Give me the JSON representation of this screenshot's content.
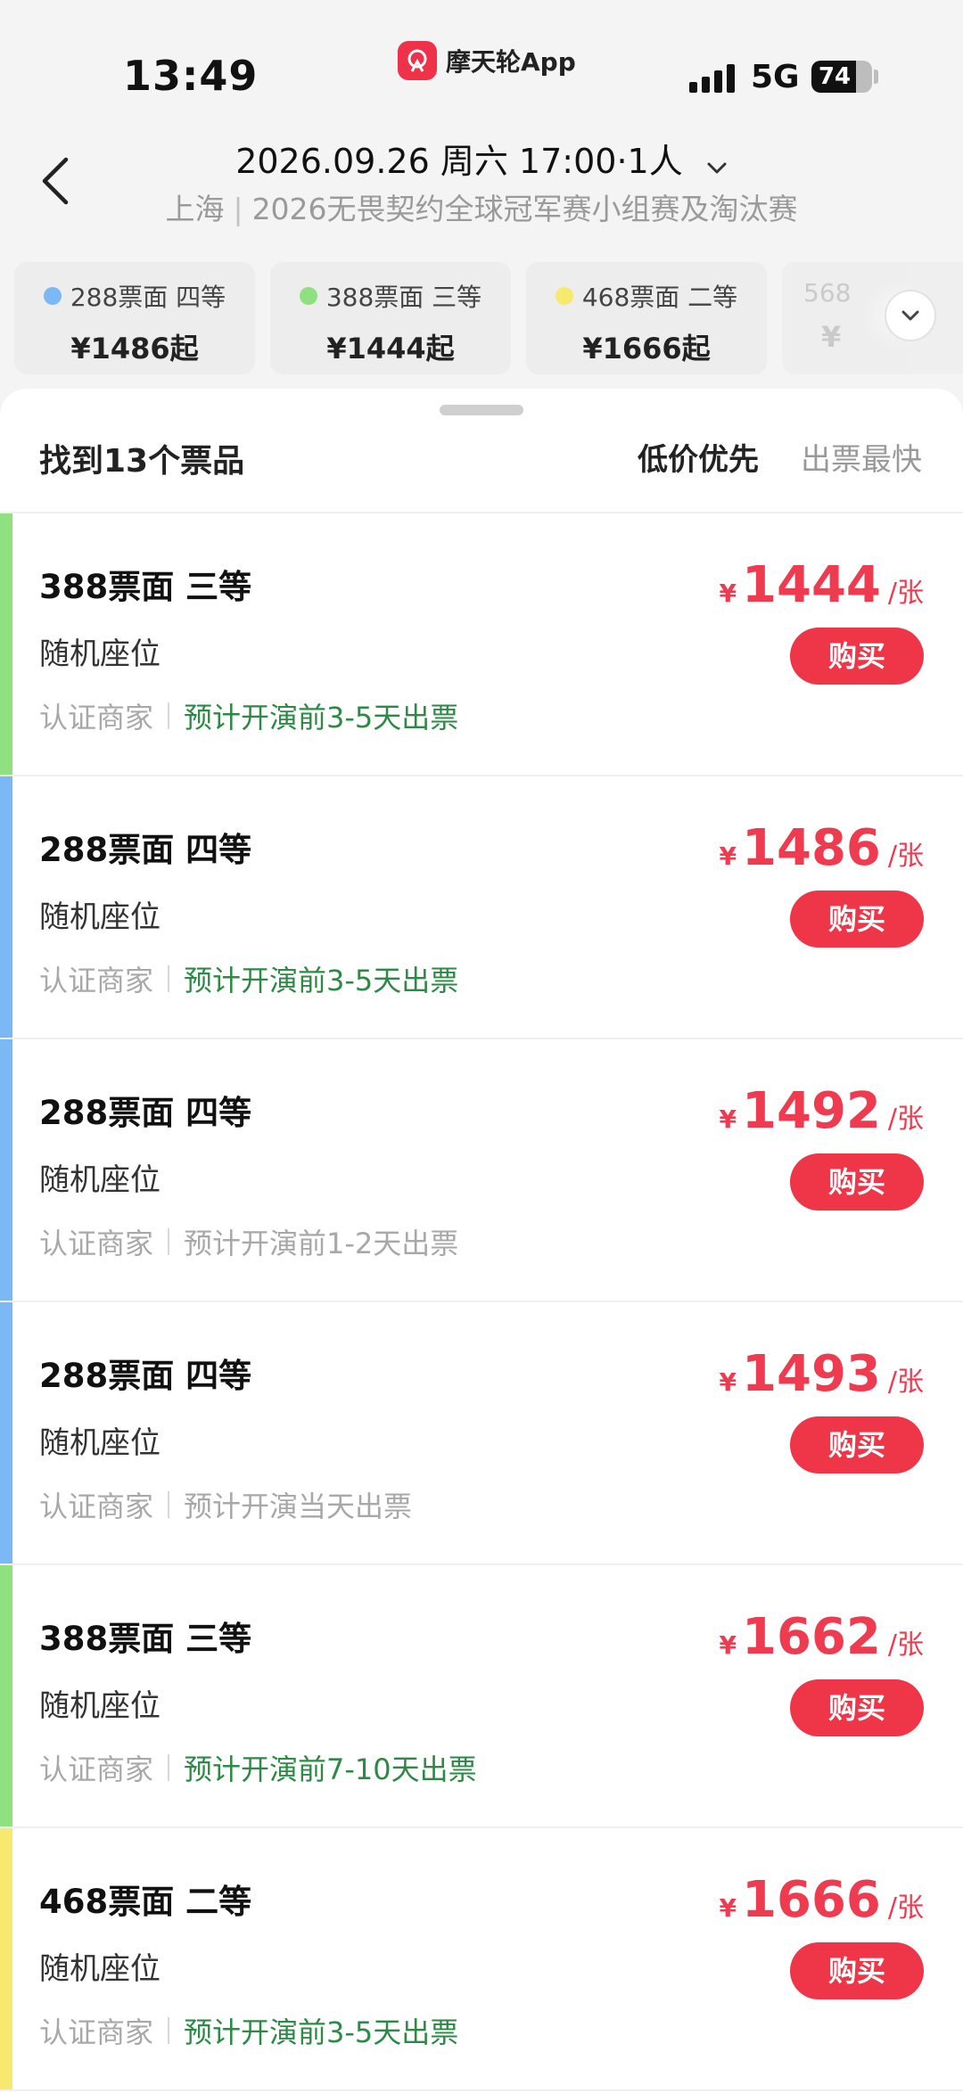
{
  "status_bar": {
    "time": "13:49",
    "app_name": "摩天轮App",
    "network": "5G",
    "battery": "74",
    "battery_level": 0.74
  },
  "header": {
    "title": "2026.09.26 周六 17:00·1人",
    "city": "上海",
    "separator": "|",
    "event": "2026无畏契约全球冠军赛小组赛及淘汰赛"
  },
  "chips": [
    {
      "label": "288票面 四等",
      "price": "¥1486起",
      "color": "#7ab9f5"
    },
    {
      "label": "388票面 三等",
      "price": "¥1444起",
      "color": "#8fe07e"
    },
    {
      "label": "468票面 二等",
      "price": "¥1666起",
      "color": "#f7e86e"
    },
    {
      "label": "568",
      "price": "¥",
      "color": ""
    }
  ],
  "results": {
    "count_text": "找到13个票品",
    "sort_low_price": "低价优先",
    "sort_fastest": "出票最快"
  },
  "tickets": [
    {
      "name": "388票面 三等",
      "seat": "随机座位",
      "merchant": "认证商家",
      "eta": "预计开演前3-5天出票",
      "eta_green": true,
      "currency": "¥",
      "price": "1444",
      "unit": "/张",
      "buy": "购买",
      "color": "#8fe07e"
    },
    {
      "name": "288票面 四等",
      "seat": "随机座位",
      "merchant": "认证商家",
      "eta": "预计开演前3-5天出票",
      "eta_green": true,
      "currency": "¥",
      "price": "1486",
      "unit": "/张",
      "buy": "购买",
      "color": "#7ab9f5"
    },
    {
      "name": "288票面 四等",
      "seat": "随机座位",
      "merchant": "认证商家",
      "eta": "预计开演前1-2天出票",
      "eta_green": false,
      "currency": "¥",
      "price": "1492",
      "unit": "/张",
      "buy": "购买",
      "color": "#7ab9f5"
    },
    {
      "name": "288票面 四等",
      "seat": "随机座位",
      "merchant": "认证商家",
      "eta": "预计开演当天出票",
      "eta_green": false,
      "currency": "¥",
      "price": "1493",
      "unit": "/张",
      "buy": "购买",
      "color": "#7ab9f5"
    },
    {
      "name": "388票面 三等",
      "seat": "随机座位",
      "merchant": "认证商家",
      "eta": "预计开演前7-10天出票",
      "eta_green": true,
      "currency": "¥",
      "price": "1662",
      "unit": "/张",
      "buy": "购买",
      "color": "#8fe07e"
    },
    {
      "name": "468票面 二等",
      "seat": "随机座位",
      "merchant": "认证商家",
      "eta": "预计开演前3-5天出票",
      "eta_green": true,
      "currency": "¥",
      "price": "1666",
      "unit": "/张",
      "buy": "购买",
      "color": "#f7e86e"
    }
  ],
  "icons": {
    "back": "chevron-left-icon",
    "title_dropdown": "chevron-down-icon",
    "chips_expand": "chevron-down-icon",
    "app_logo": "ferris-wheel-logo-icon"
  },
  "colors": {
    "accent": "#ee3648",
    "price": "#ef3b50",
    "eta_green": "#2d8a45"
  }
}
